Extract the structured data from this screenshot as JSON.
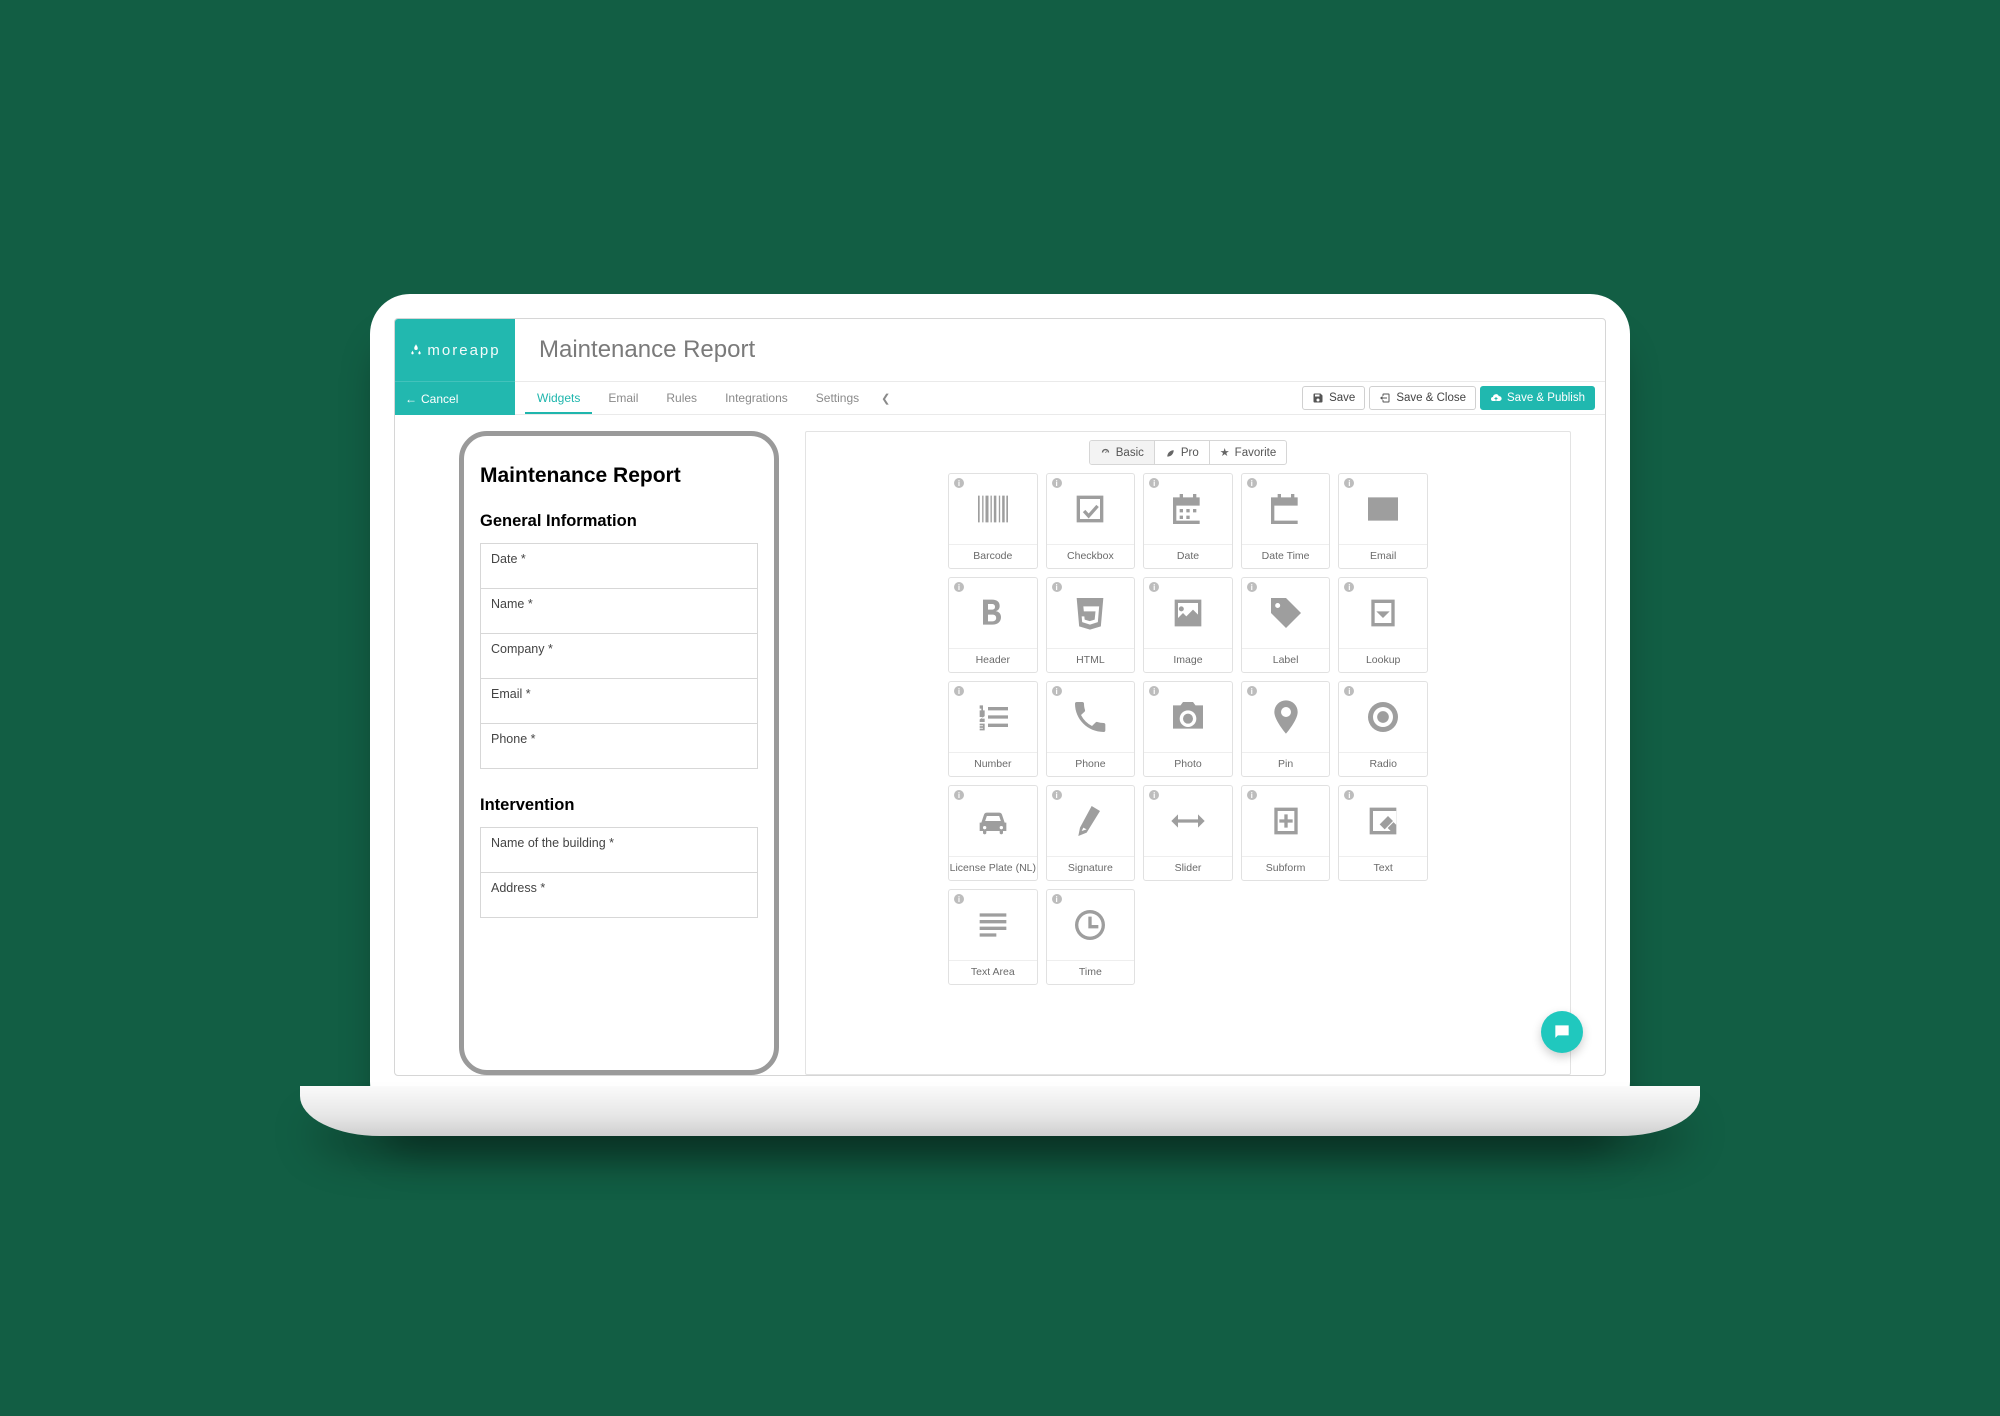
{
  "brand": {
    "name": "moreapp",
    "cancel": "Cancel"
  },
  "page": {
    "title": "Maintenance Report"
  },
  "tabs": {
    "items": [
      "Widgets",
      "Email",
      "Rules",
      "Integrations",
      "Settings"
    ],
    "active": "Widgets"
  },
  "actions": {
    "save": "Save",
    "save_close": "Save & Close",
    "save_publish": "Save & Publish"
  },
  "filters": {
    "basic": "Basic",
    "pro": "Pro",
    "favorite": "Favorite",
    "active": "Basic"
  },
  "preview": {
    "title": "Maintenance Report",
    "sections": [
      {
        "heading": "General Information",
        "fields": [
          "Date *",
          "Name *",
          "Company *",
          "Email *",
          "Phone *"
        ]
      },
      {
        "heading": "Intervention",
        "fields": [
          "Name of the building *",
          "Address *"
        ]
      }
    ]
  },
  "widgets": [
    {
      "id": "barcode",
      "label": "Barcode"
    },
    {
      "id": "checkbox",
      "label": "Checkbox"
    },
    {
      "id": "date",
      "label": "Date"
    },
    {
      "id": "datetime",
      "label": "Date Time"
    },
    {
      "id": "email",
      "label": "Email"
    },
    {
      "id": "header",
      "label": "Header"
    },
    {
      "id": "html",
      "label": "HTML"
    },
    {
      "id": "image",
      "label": "Image"
    },
    {
      "id": "label",
      "label": "Label"
    },
    {
      "id": "lookup",
      "label": "Lookup"
    },
    {
      "id": "number",
      "label": "Number"
    },
    {
      "id": "phone",
      "label": "Phone"
    },
    {
      "id": "photo",
      "label": "Photo"
    },
    {
      "id": "pin",
      "label": "Pin"
    },
    {
      "id": "radio",
      "label": "Radio"
    },
    {
      "id": "license",
      "label": "License Plate (NL)"
    },
    {
      "id": "signature",
      "label": "Signature"
    },
    {
      "id": "slider",
      "label": "Slider"
    },
    {
      "id": "subform",
      "label": "Subform"
    },
    {
      "id": "text",
      "label": "Text"
    },
    {
      "id": "textarea",
      "label": "Text Area"
    },
    {
      "id": "time",
      "label": "Time"
    }
  ]
}
